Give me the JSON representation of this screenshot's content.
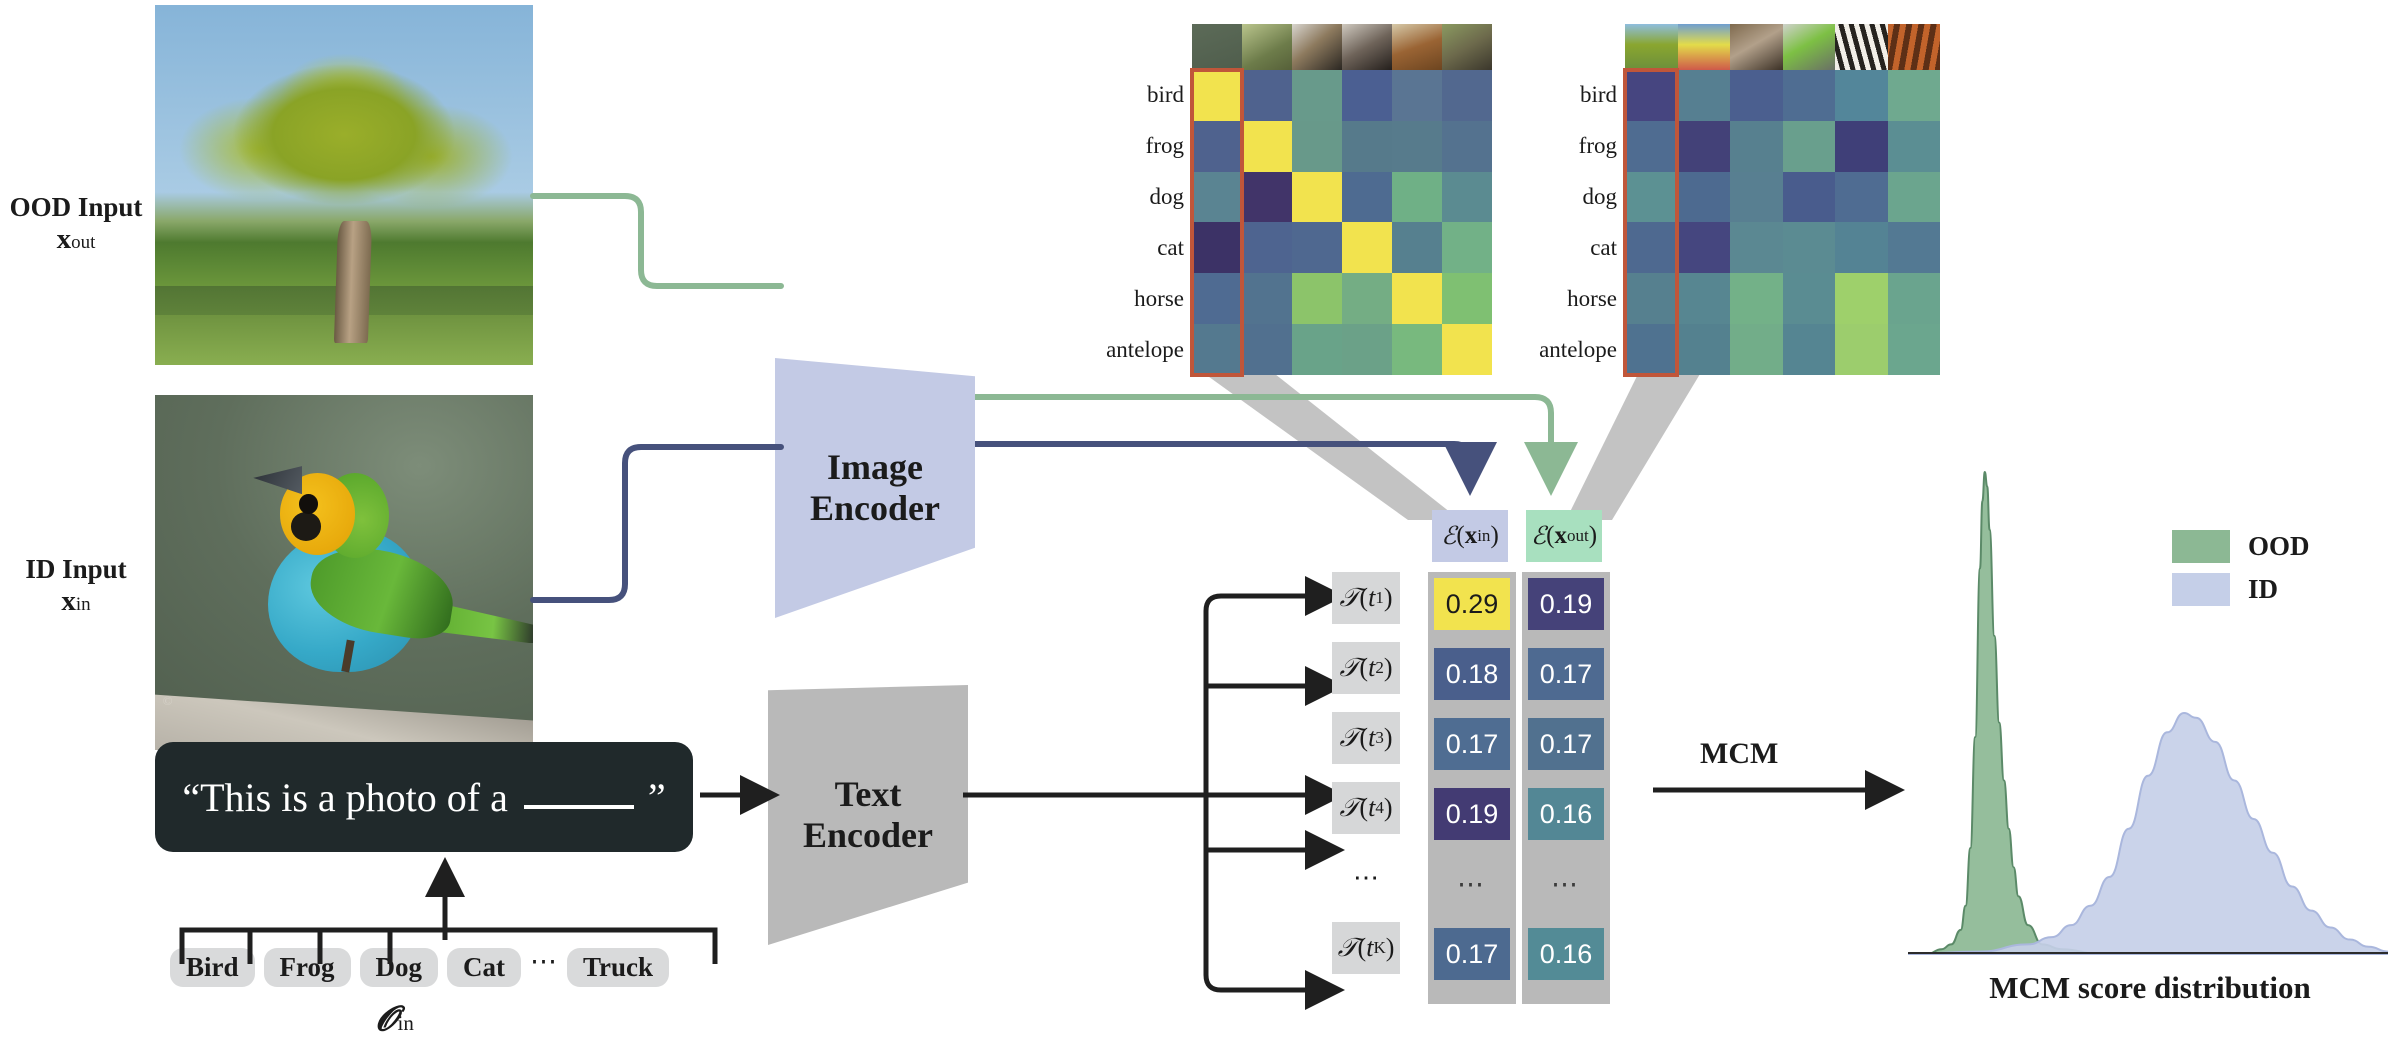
{
  "labels": {
    "ood_input": "OOD Input",
    "ood_input_sub": "x_out",
    "id_input": "ID Input",
    "id_input_sub": "x_in",
    "image_encoder": "Image\nEncoder",
    "text_encoder": "Text\nEncoder",
    "mcm_arrow": "MCM",
    "label_set_symbol": "Y_in"
  },
  "prompt": {
    "prefix": "“This is a photo of a",
    "suffix": "”"
  },
  "class_chips": [
    "Bird",
    "Frog",
    "Dog",
    "Cat",
    "Truck"
  ],
  "chip_ellipsis": "⋯",
  "heatmap_id": {
    "row_labels": [
      "bird",
      "frog",
      "dog",
      "cat",
      "horse",
      "antelope"
    ],
    "thumbnails": [
      "bird-thumb",
      "frog-thumb",
      "dog-thumb",
      "cat-thumb",
      "horse-thumb",
      "antelope-thumb"
    ],
    "highlight_column": 1,
    "highlight_color": "#c0563a",
    "cells": [
      [
        "#f2e34e",
        "#4f628e",
        "#689a8b",
        "#4b5f92",
        "#5a7593",
        "#52688f"
      ],
      [
        "#4f628e",
        "#f2e34e",
        "#68998a",
        "#567a8b",
        "#577b8c",
        "#54728f"
      ],
      [
        "#5a8492",
        "#413469",
        "#f2e34e",
        "#4e6b91",
        "#6fb086",
        "#5b8b91"
      ],
      [
        "#3c3266",
        "#4e6490",
        "#4f6890",
        "#f2e34e",
        "#56808f",
        "#72b187"
      ],
      [
        "#4f6b92",
        "#52738f",
        "#8cc46a",
        "#74ad84",
        "#f2e34e",
        "#7fc072"
      ],
      [
        "#54798f",
        "#51708f",
        "#69a389",
        "#6ba188",
        "#78b97e",
        "#f2e34e"
      ]
    ]
  },
  "heatmap_ood": {
    "row_labels": [
      "bird",
      "frog",
      "dog",
      "cat",
      "horse",
      "antelope"
    ],
    "thumbnails": [
      "tree-thumb",
      "balloon-thumb",
      "wolf-thumb",
      "lizard-thumb",
      "zebra-thumb",
      "braid-thumb"
    ],
    "highlight_column": 1,
    "highlight_color": "#c0563a",
    "cells": [
      [
        "#464580",
        "#567f91",
        "#4b5f8f",
        "#4f6d92",
        "#53869a",
        "#6fa98f"
      ],
      [
        "#4f6c91",
        "#434178",
        "#57808f",
        "#699f8d",
        "#3f3f78",
        "#5b8e93"
      ],
      [
        "#5c9193",
        "#4d6a90",
        "#587f91",
        "#495c8d",
        "#4f6c92",
        "#6ba58e"
      ],
      [
        "#4e6990",
        "#45467f",
        "#5b8892",
        "#5b8b92",
        "#548394",
        "#537993"
      ],
      [
        "#56808f",
        "#578691",
        "#73b188",
        "#5a8c92",
        "#9ed06b",
        "#6aa48e"
      ],
      [
        "#4f7290",
        "#54818f",
        "#72ad89",
        "#558592",
        "#9ccd6d",
        "#6ba68e"
      ]
    ]
  },
  "score_table": {
    "text_tokens": [
      "T(t1)",
      "T(t2)",
      "T(t3)",
      "T(t4)",
      "T(tK)"
    ],
    "ellipsis": "⋯",
    "columns": [
      {
        "header": "I(x_in)",
        "header_color": "#c3cae5",
        "values": [
          "0.29",
          "0.18",
          "0.17",
          "0.19",
          "0.17"
        ],
        "cell_colors": [
          "#f2e34e",
          "#4a5f8c",
          "#4f6d92",
          "#433b73",
          "#4d6a90"
        ],
        "text_colors": [
          "#1b1b1b",
          "#ffffff",
          "#ffffff",
          "#ffffff",
          "#ffffff"
        ]
      },
      {
        "header": "I(x_out)",
        "header_color": "#a8e0bf",
        "values": [
          "0.19",
          "0.17",
          "0.17",
          "0.16",
          "0.16"
        ],
        "cell_colors": [
          "#454279",
          "#4e6a91",
          "#51718f",
          "#538795",
          "#538b96"
        ],
        "text_colors": [
          "#ffffff",
          "#ffffff",
          "#ffffff",
          "#ffffff",
          "#ffffff"
        ]
      }
    ]
  },
  "chart_data": {
    "type": "area",
    "title": "",
    "xlabel": "MCM score distribution",
    "ylabel": "",
    "grid": false,
    "legend_position": "top-right",
    "axis_ranges": {
      "xlim": [
        0,
        1
      ],
      "ylim": [
        0,
        1
      ]
    },
    "series": [
      {
        "name": "OOD",
        "color": "#8cb894",
        "edge_color": "#5b8a68",
        "peak_x": 0.16,
        "peak_y": 1.0,
        "spread": 0.035,
        "x": [
          0.0,
          0.04,
          0.07,
          0.09,
          0.11,
          0.12,
          0.13,
          0.14,
          0.15,
          0.155,
          0.16,
          0.165,
          0.17,
          0.18,
          0.19,
          0.2,
          0.21,
          0.22,
          0.23,
          0.25,
          0.28,
          0.32,
          0.4,
          0.55,
          0.75,
          1.0
        ],
        "y": [
          0.0,
          0.0,
          0.01,
          0.02,
          0.05,
          0.1,
          0.22,
          0.45,
          0.8,
          0.94,
          1.0,
          0.97,
          0.88,
          0.66,
          0.48,
          0.36,
          0.26,
          0.18,
          0.12,
          0.06,
          0.02,
          0.01,
          0.0,
          0.0,
          0.0,
          0.0
        ]
      },
      {
        "name": "ID",
        "color": "#c5cfe8",
        "edge_color": "#aab7dd",
        "peak_x": 0.585,
        "peak_y": 0.5,
        "spread": 0.12,
        "x": [
          0.0,
          0.15,
          0.25,
          0.3,
          0.34,
          0.38,
          0.42,
          0.46,
          0.5,
          0.54,
          0.575,
          0.6,
          0.64,
          0.68,
          0.72,
          0.76,
          0.8,
          0.84,
          0.88,
          0.92,
          0.96,
          1.0
        ],
        "y": [
          0.0,
          0.005,
          0.02,
          0.035,
          0.06,
          0.1,
          0.16,
          0.26,
          0.37,
          0.46,
          0.5,
          0.49,
          0.44,
          0.36,
          0.28,
          0.21,
          0.14,
          0.09,
          0.055,
          0.03,
          0.015,
          0.005
        ]
      }
    ],
    "legend": [
      {
        "label": "OOD",
        "color": "#8cb894"
      },
      {
        "label": "ID",
        "color": "#c5cfe8"
      }
    ]
  },
  "colors": {
    "ood_flow": "#8cb894",
    "id_flow": "#46517c",
    "highlight": "#c0563a",
    "grey_panel": "#b9b9b9",
    "token_cell": "#d6d7d8"
  }
}
